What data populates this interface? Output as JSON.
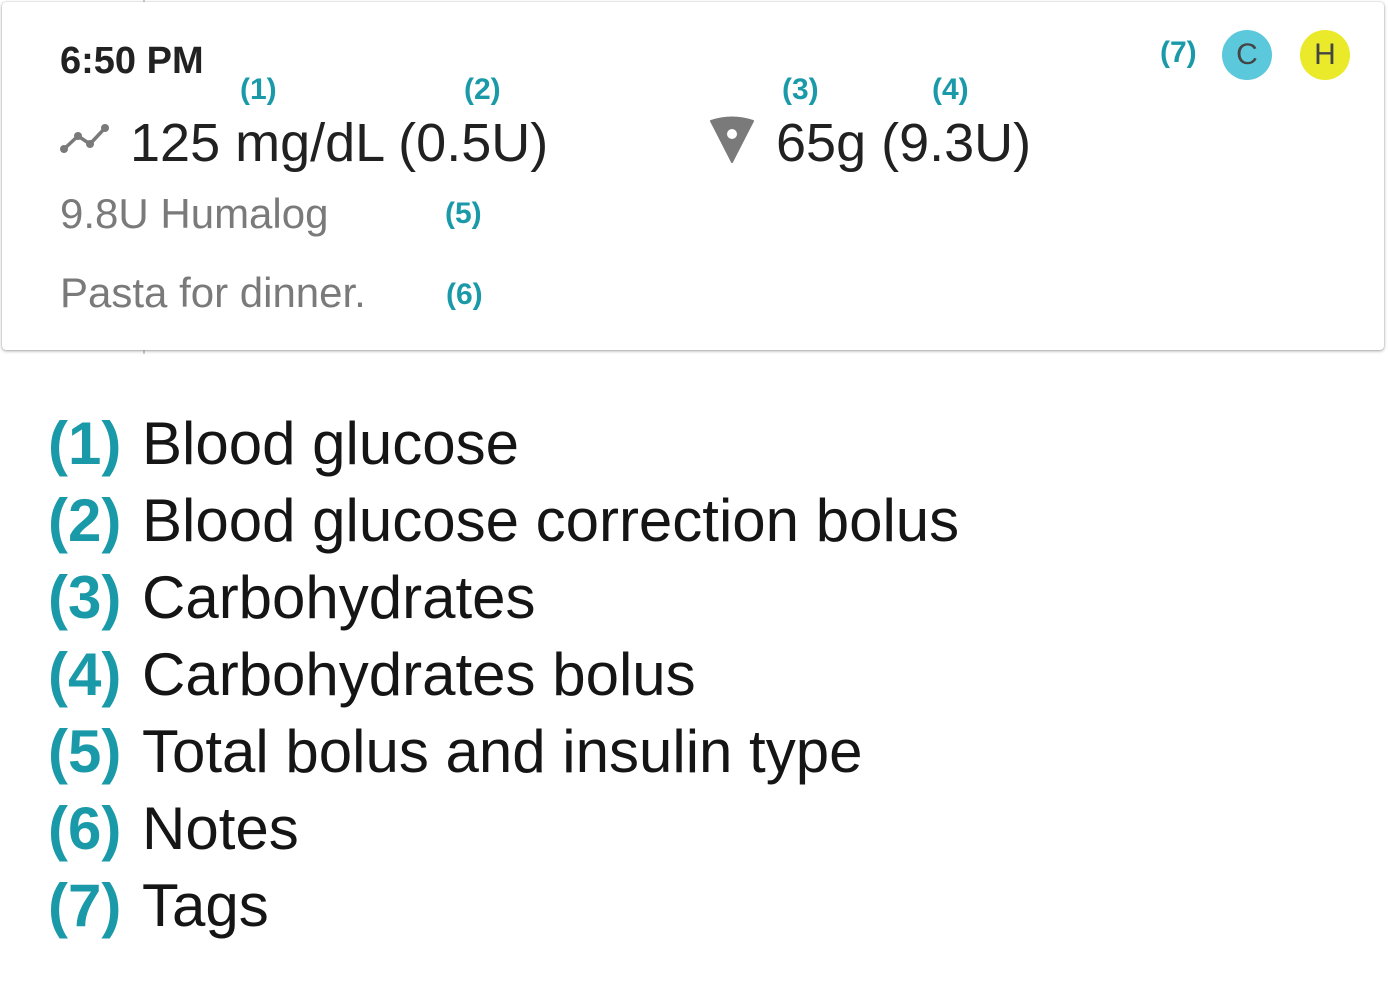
{
  "entry": {
    "time": "6:50 PM",
    "glucose_value": "125 mg/dL (0.5U)",
    "carbs_value": "65g (9.3U)",
    "insulin": "9.8U Humalog",
    "notes": "Pasta for dinner.",
    "icons": {
      "glucose": "trend-line-icon",
      "carbs": "pizza-slice-icon"
    },
    "tags": [
      {
        "label": "C",
        "color": "#5bc8dc"
      },
      {
        "label": "H",
        "color": "#eaea2a"
      }
    ]
  },
  "callouts": {
    "glucose": "(1)",
    "correction": "(2)",
    "carbs": "(3)",
    "carbs_bolus": "(4)",
    "total": "(5)",
    "notes": "(6)",
    "tags": "(7)"
  },
  "legend": [
    {
      "num": "(1)",
      "label": "Blood glucose"
    },
    {
      "num": "(2)",
      "label": "Blood glucose correction bolus"
    },
    {
      "num": "(3)",
      "label": "Carbohydrates"
    },
    {
      "num": "(4)",
      "label": "Carbohydrates bolus"
    },
    {
      "num": "(5)",
      "label": "Total bolus and insulin type"
    },
    {
      "num": "(6)",
      "label": "Notes"
    },
    {
      "num": "(7)",
      "label": "Tags"
    }
  ],
  "colors": {
    "accent": "#1a9aa8",
    "tag_c": "#5bc8dc",
    "tag_h": "#eaea2a"
  }
}
